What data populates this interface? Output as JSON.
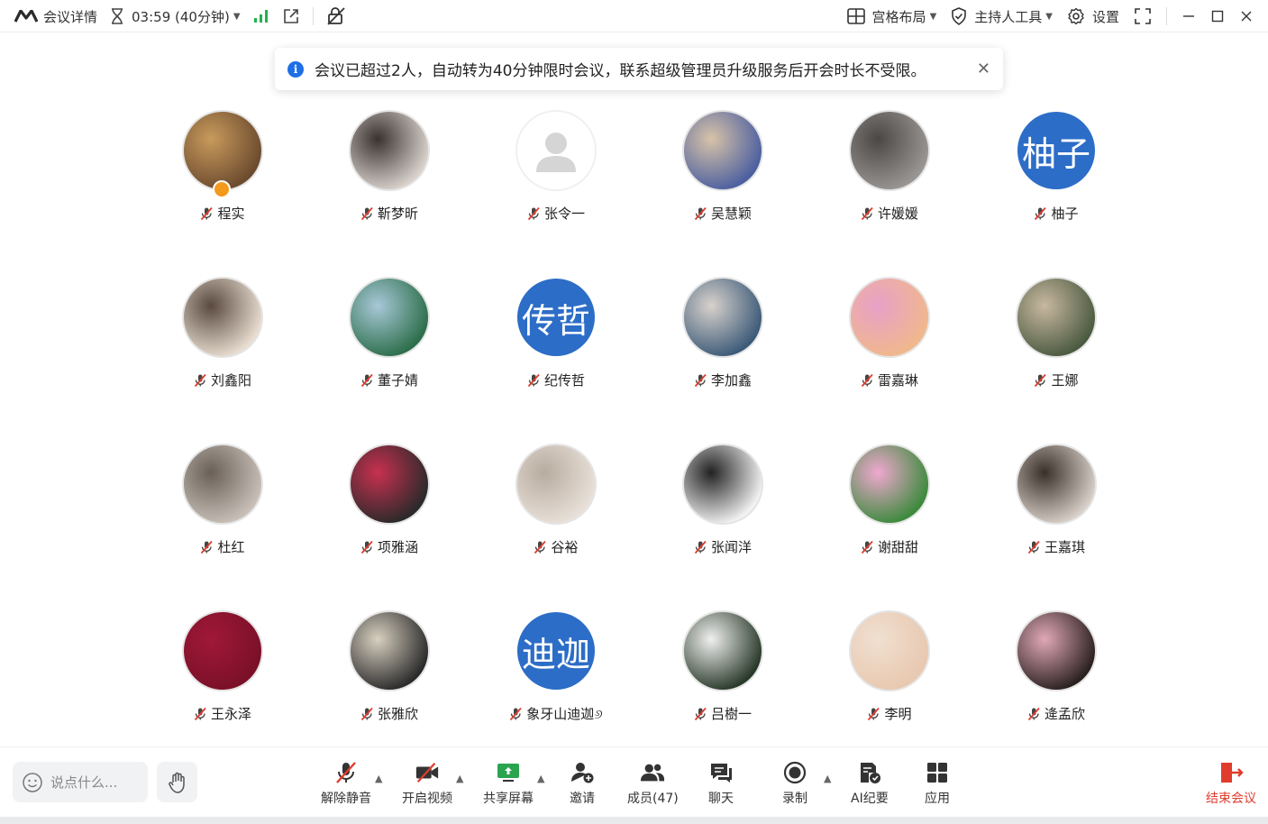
{
  "topbar": {
    "meeting_details": "会议详情",
    "timer": "03:59 (40分钟)",
    "layout": "宫格布局",
    "host_tools": "主持人工具",
    "settings": "设置"
  },
  "notice": {
    "text": "会议已超过2人，自动转为40分钟限时会议，联系超级管理员升级服务后开会时长不受限。"
  },
  "participants": [
    {
      "name": "程实"
    },
    {
      "name": "靳梦昕"
    },
    {
      "name": "张令一"
    },
    {
      "name": "吴慧颖"
    },
    {
      "name": "许媛媛"
    },
    {
      "name": "柚子",
      "avatar_text": "柚子"
    },
    {
      "name": "刘鑫阳"
    },
    {
      "name": "董子婧"
    },
    {
      "name": "纪传哲",
      "avatar_text": "传哲"
    },
    {
      "name": "李加鑫"
    },
    {
      "name": "雷嘉琳"
    },
    {
      "name": "王娜"
    },
    {
      "name": "杜红"
    },
    {
      "name": "项雅涵"
    },
    {
      "name": "谷裕"
    },
    {
      "name": "张闻洋"
    },
    {
      "name": "谢甜甜"
    },
    {
      "name": "王嘉琪"
    },
    {
      "name": "王永泽"
    },
    {
      "name": "张雅欣"
    },
    {
      "name": "象牙山迪迦୬",
      "avatar_text": "迪迦"
    },
    {
      "name": "吕樹一"
    },
    {
      "name": "李明"
    },
    {
      "name": "逄孟欣"
    }
  ],
  "bottombar": {
    "chat_placeholder": "说点什么...",
    "unmute": "解除静音",
    "start_video": "开启视频",
    "share_screen": "共享屏幕",
    "invite": "邀请",
    "members": "成员(47)",
    "chat": "聊天",
    "record": "录制",
    "ai_minutes": "AI纪要",
    "apps": "应用",
    "end_meeting": "结束会议"
  },
  "colors": {
    "accent": "#1e6fe6",
    "avatar_blue": "#2c6dc7",
    "muted_red": "#e03c2e",
    "signal_green": "#22b14c"
  }
}
